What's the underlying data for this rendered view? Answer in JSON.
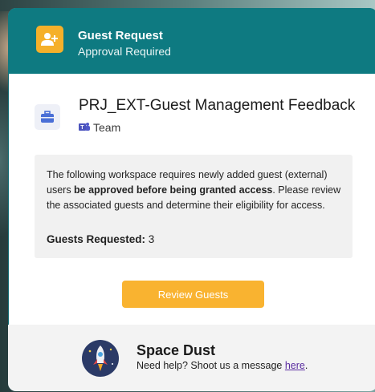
{
  "header": {
    "title": "Guest Request",
    "subtitle": "Approval Required",
    "icon": "add-person-icon",
    "accent": "#0e7a81",
    "icon_color": "#f5b02a"
  },
  "workspace": {
    "title": "PRJ_EXT-Guest Management Feedback",
    "type": "Team",
    "icon": "briefcase-icon",
    "type_icon": "teams-icon"
  },
  "info": {
    "text_before": "The following workspace requires newly added guest (external) users ",
    "text_bold": "be approved before being granted access",
    "text_after": ". Please review the associated guests and determine their eligibility for access.",
    "guests_label": "Guests Requested:",
    "guests_count": "3"
  },
  "actions": {
    "review_label": "Review Guests",
    "button_color": "#f9b330"
  },
  "footer": {
    "brand": "Space Dust",
    "help_text": "Need help? Shoot us a message ",
    "help_link": "here",
    "help_end": ".",
    "logo": "rocket-logo"
  }
}
